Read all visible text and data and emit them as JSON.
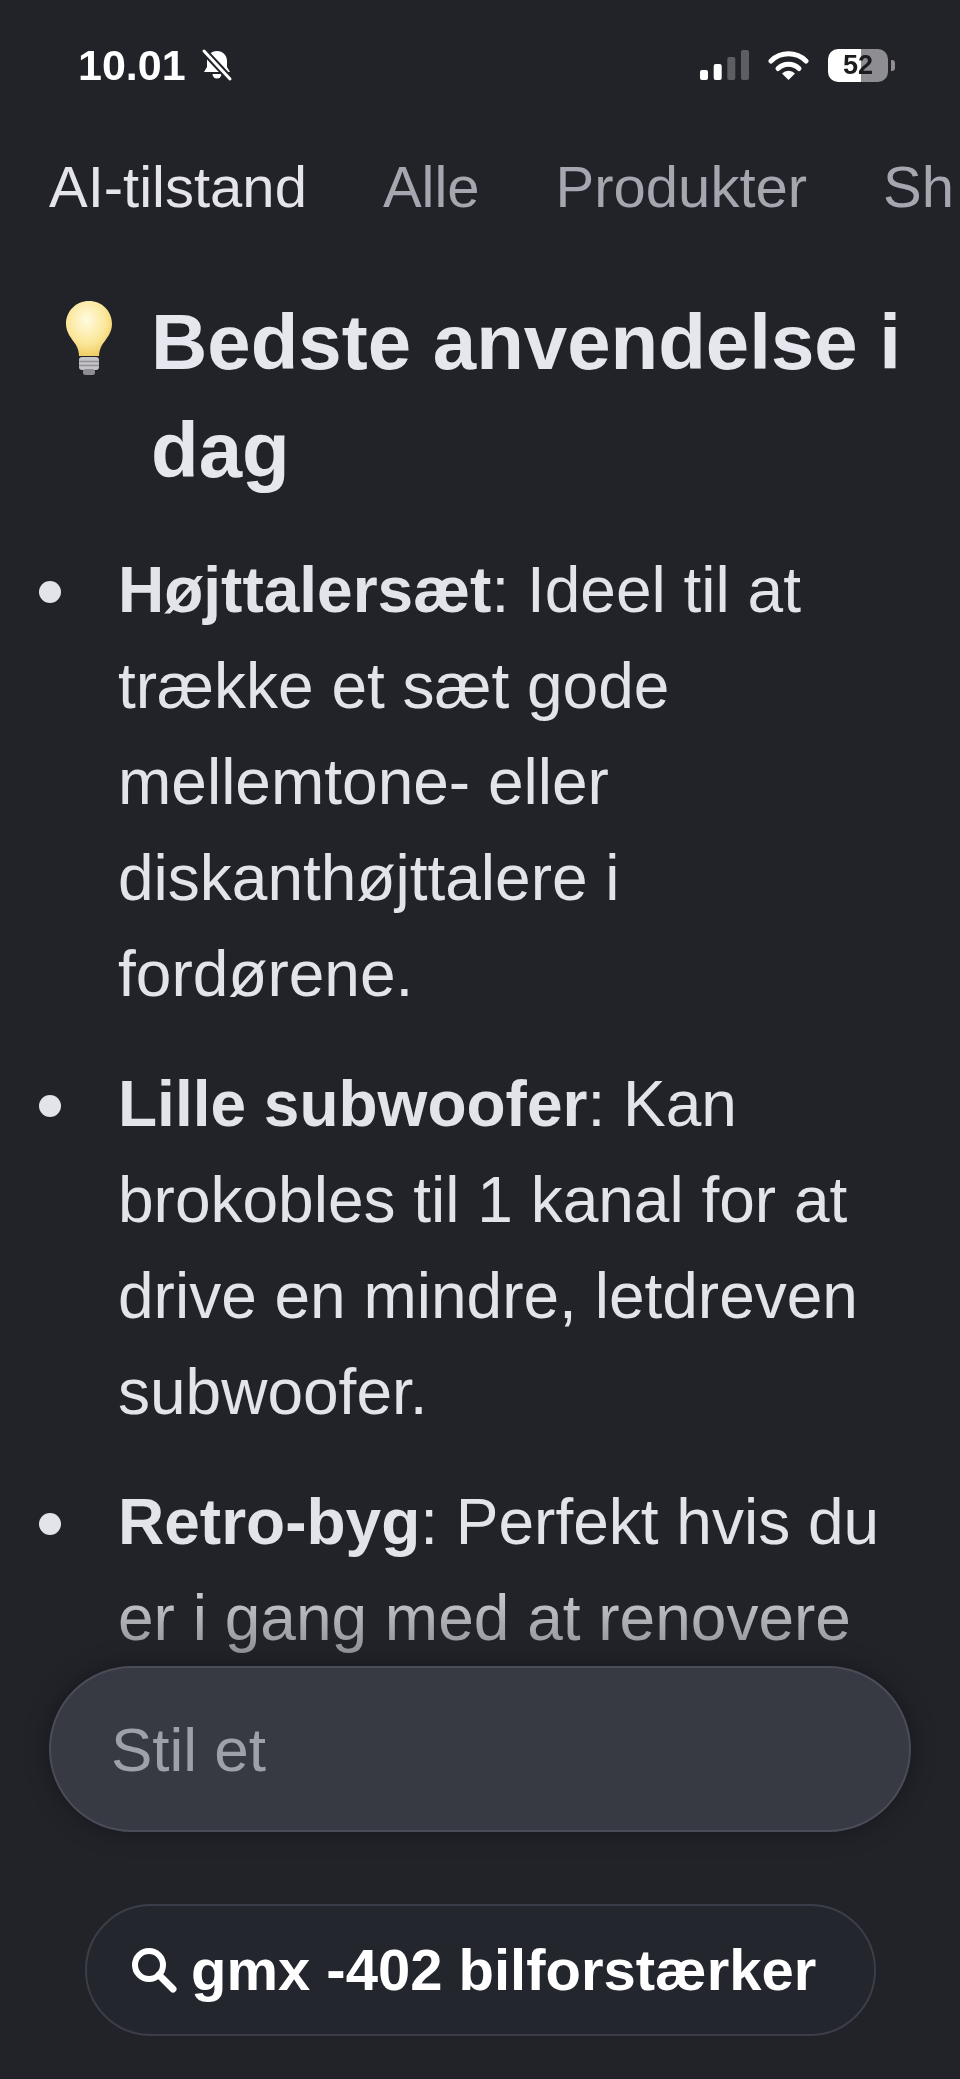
{
  "status_bar": {
    "time": "10.01",
    "battery": "52"
  },
  "tabs": [
    {
      "label": "AI-tilstand",
      "selected": true
    },
    {
      "label": "Alle",
      "selected": false
    },
    {
      "label": "Produkter",
      "selected": false
    },
    {
      "label": "Sh",
      "selected": false
    }
  ],
  "heading": "Bedste anvendelse i dag",
  "bullets": [
    {
      "text": "**Højttalersæt**: Ideel til at trække et sæt gode mellemtone- eller diskanthøjttalere i fordørene."
    },
    {
      "text": "**Lille subwoofer**: Kan brokobles til 1 kanal for at drive en mindre, letdreven subwoofer."
    },
    {
      "text": "**Retro-byg**: Perfekt hvis du er i gang med at renovere"
    }
  ],
  "composer": {
    "placeholder": "Stil et"
  },
  "search_chip": {
    "query": "gmx -402 bilforstærker"
  }
}
